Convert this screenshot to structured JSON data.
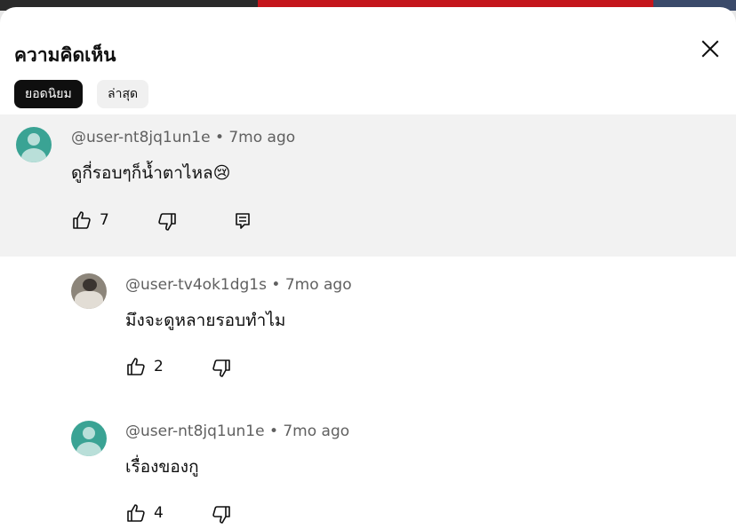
{
  "header": {
    "title": "ความคิดเห็น",
    "close_icon": "close-icon"
  },
  "sort_chips": [
    {
      "label": "ยอดนิยม",
      "selected": true
    },
    {
      "label": "ล่าสุด",
      "selected": false
    }
  ],
  "comments": [
    {
      "username": "@user-nt8jq1un1e",
      "time": "7mo ago",
      "meta": "@user-nt8jq1un1e • 7mo ago",
      "text": "ดูกี่รอบๆก็น้ำตาไหล😢",
      "likes": "7",
      "avatar": "default-green-avatar"
    },
    {
      "username": "@user-tv4ok1dg1s",
      "time": "7mo ago",
      "meta": "@user-tv4ok1dg1s • 7mo ago",
      "text": "มึงจะดูหลายรอบทำไม",
      "likes": "2",
      "avatar": "photo-avatar"
    },
    {
      "username": "@user-nt8jq1un1e",
      "time": "7mo ago",
      "meta": "@user-nt8jq1un1e • 7mo ago",
      "text": "เรื่องของกู",
      "likes": "4",
      "avatar": "default-green-avatar"
    }
  ],
  "colors": {
    "accent_dark": "#0f0f0f",
    "meta_gray": "#606060",
    "highlight_bg": "#f2f2f2",
    "avatar_green": "#3aa394"
  }
}
